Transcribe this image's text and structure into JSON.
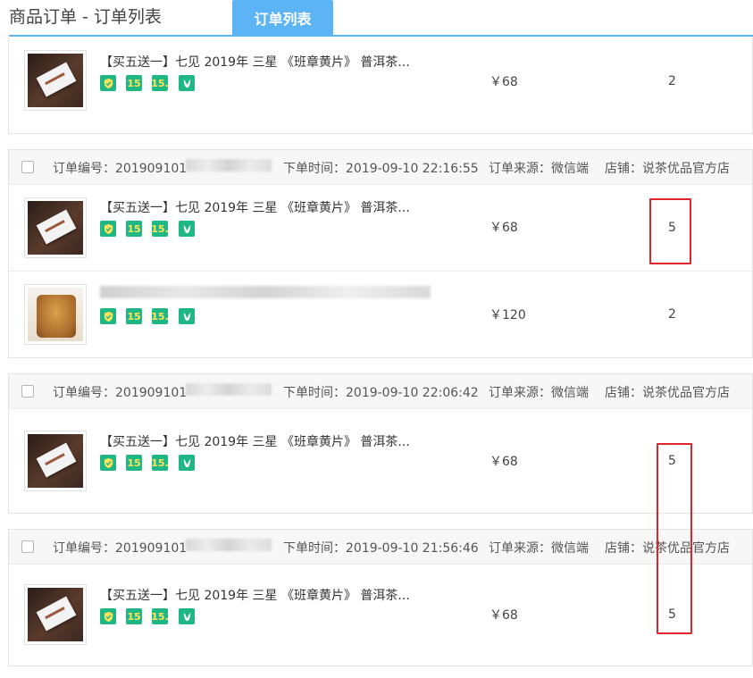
{
  "header": {
    "breadcrumb": "商品订单 - 订单列表",
    "active_tab": "订单列表"
  },
  "orders": [
    {
      "items": [
        {
          "title": "【买五送一】七见 2019年 三星 《班章黄片》 普洱茶...",
          "price": "￥68",
          "qty": "2"
        }
      ]
    },
    {
      "order_no": "订单编号：201909101",
      "order_time": "下单时间：2019-09-10 22:16:55",
      "source": "订单来源：微信端",
      "shop": "店铺：说茶优品官方店",
      "items": [
        {
          "title": "【买五送一】七见 2019年 三星 《班章黄片》 普洱茶...",
          "price": "￥68",
          "qty": "5"
        },
        {
          "title": "",
          "price": "￥120",
          "qty": "2"
        }
      ]
    },
    {
      "order_no": "订单编号：201909101",
      "order_time": "下单时间：2019-09-10 22:06:42",
      "source": "订单来源：微信端",
      "shop": "店铺：说茶优品官方店",
      "items": [
        {
          "title": "【买五送一】七见 2019年 三星 《班章黄片》 普洱茶...",
          "price": "￥68",
          "qty": "5"
        }
      ]
    },
    {
      "order_no": "订单编号：201909101",
      "order_time": "下单时间：2019-09-10 21:56:46",
      "source": "订单来源：微信端",
      "shop": "店铺：说茶优品官方店",
      "items": [
        {
          "title": "【买五送一】七见 2019年 三星 《班章黄片》 普洱茶...",
          "price": "￥68",
          "qty": "5"
        }
      ]
    }
  ],
  "badges": {
    "b2": "15",
    "b3": "15.",
    "icons": [
      "shield-check-icon",
      "badge-15-icon",
      "badge-15-dot-icon",
      "leaf-v-icon"
    ]
  },
  "colors": {
    "tab": "#5db4f5",
    "badge": "#1fb784",
    "highlight": "#e0262b"
  }
}
